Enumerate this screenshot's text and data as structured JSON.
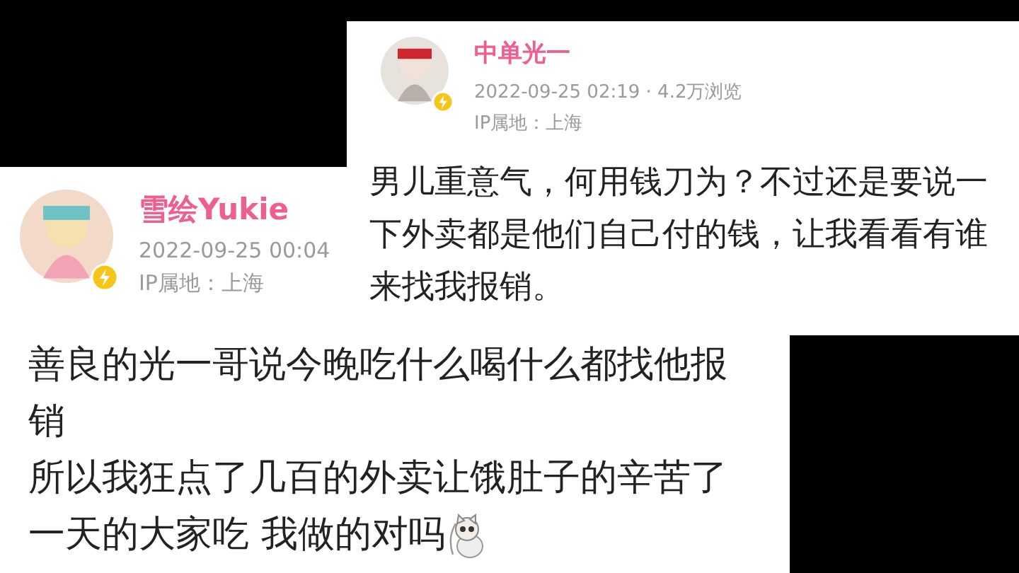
{
  "posts": [
    {
      "author": "雪绘Yukie",
      "meta": [
        "2022-09-25 00:04",
        "IP属地：上海"
      ],
      "paragraphs": [
        "善良的光一哥说今晚吃什么喝什么都找他报销",
        "所以我狂点了几百的外卖让饿肚子的辛苦了",
        "一天的大家吃 我做的对吗"
      ],
      "sticker": true,
      "verified": true
    },
    {
      "author": "中单光一",
      "meta": [
        "2022-09-25 02:19 · 4.2万浏览",
        "IP属地：上海"
      ],
      "paragraphs": [
        "男儿重意气，何用钱刀为？不过还是要说一下外卖都是他们自己付的钱，让我看看有谁来找我报销。"
      ],
      "sticker": false,
      "verified": true
    }
  ]
}
